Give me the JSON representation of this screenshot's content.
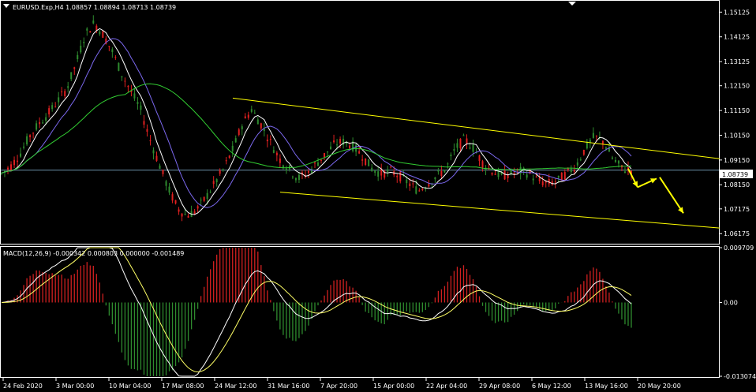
{
  "chart_data": [
    {
      "type": "candlestick",
      "title": "EURUSD.Exp,H4  1.08857 1.08894 1.08713 1.08739",
      "symbol": "EURUSD.Exp",
      "timeframe": "H4",
      "ohlc": {
        "open": 1.08857,
        "high": 1.08894,
        "low": 1.08713,
        "close": 1.08739
      },
      "current_price_label": "1.08739",
      "ylim": [
        1.058,
        1.1555
      ],
      "y_ticks": [
        "1.15125",
        "1.14125",
        "1.13125",
        "1.12150",
        "1.11150",
        "1.10150",
        "1.09150",
        "1.08150",
        "1.07175",
        "1.06175"
      ],
      "x_ticks": [
        "24 Feb 2020",
        "3 Mar 00:00",
        "10 Mar 04:00",
        "17 Mar 08:00",
        "24 Mar 12:00",
        "31 Mar 16:00",
        "7 Apr 20:00",
        "15 Apr 00:00",
        "22 Apr 04:00",
        "29 Apr 08:00",
        "6 May 12:00",
        "13 May 16:00",
        "20 May 20:00"
      ],
      "approx_close_path": [
        1.086,
        1.089,
        1.094,
        1.101,
        1.106,
        1.11,
        1.115,
        1.12,
        1.13,
        1.142,
        1.147,
        1.142,
        1.135,
        1.126,
        1.119,
        1.112,
        1.1,
        1.09,
        1.08,
        1.072,
        1.069,
        1.071,
        1.076,
        1.082,
        1.088,
        1.096,
        1.106,
        1.112,
        1.106,
        1.099,
        1.092,
        1.088,
        1.084,
        1.086,
        1.09,
        1.094,
        1.098,
        1.099,
        1.097,
        1.093,
        1.088,
        1.086,
        1.087,
        1.085,
        1.082,
        1.079,
        1.082,
        1.085,
        1.088,
        1.096,
        1.1,
        1.096,
        1.09,
        1.087,
        1.085,
        1.086,
        1.087,
        1.086,
        1.083,
        1.082,
        1.083,
        1.086,
        1.089,
        1.096,
        1.101,
        1.099,
        1.092,
        1.088,
        1.0874
      ],
      "trendlines": [
        {
          "from": [
            295,
            1.1165
          ],
          "to": [
            912,
            1.092
          ],
          "color": "#ffff00"
        },
        {
          "from": [
            355,
            1.0785
          ],
          "to": [
            912,
            1.064
          ],
          "color": "#ffff00"
        }
      ],
      "arrows": [
        {
          "points": [
            [
              796,
              1.088
            ],
            [
              808,
              1.0805
            ]
          ],
          "color": "#ffff00"
        },
        {
          "points": [
            [
              808,
              1.0805
            ],
            [
              832,
              1.084
            ]
          ],
          "color": "#ffff00"
        },
        {
          "points": [
            [
              836,
              1.0845
            ],
            [
              866,
              1.07
            ]
          ],
          "color": "#ffff00"
        }
      ],
      "colors": {
        "bull": "#2e8b2e",
        "bear": "#e02020",
        "ma_fast": "#ffffff",
        "ma_mid": "#7b68ee",
        "ma_slow": "#32cd32",
        "price_line": "#6a8fa8"
      }
    },
    {
      "type": "bar",
      "title": "MACD(12,26,9) -0.000342 0.000803 0.000000 -0.001489",
      "indicator": "MACD(12,26,9)",
      "values_text": "-0.000342 0.000803 0.000000 -0.001489",
      "ylim": [
        -0.01307,
        0.00971
      ],
      "y_ticks": [
        "0.009709",
        "0.00",
        "-0.013074"
      ],
      "colors": {
        "hist_pos": "#d02020",
        "hist_neg": "#2e8b2e",
        "line": "#ffffff",
        "signal": "#ffff66"
      }
    }
  ]
}
